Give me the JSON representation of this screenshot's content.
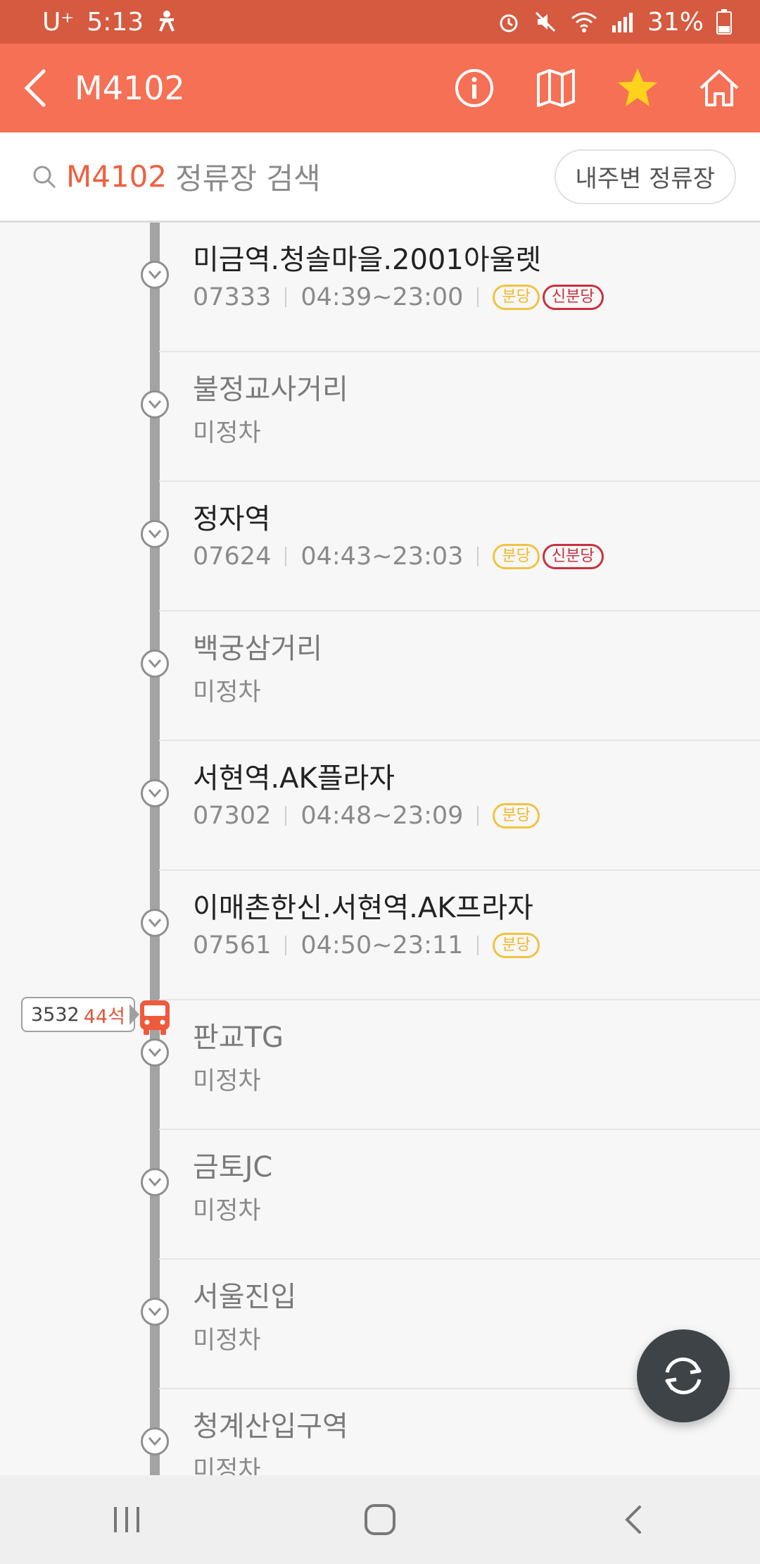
{
  "status": {
    "carrier": "U⁺",
    "time": "5:13",
    "battery": "31%"
  },
  "app_bar": {
    "title": "M4102"
  },
  "search": {
    "route": "M4102",
    "placeholder": "정류장 검색",
    "nearby_label": "내주변 정류장"
  },
  "stops": [
    {
      "name": "미금역.청솔마을.2001아울렛",
      "active": true,
      "code": "07333",
      "hours": "04:39~23:00",
      "badges": [
        {
          "text": "분당",
          "color": "yellow"
        },
        {
          "text": "신분당",
          "color": "red"
        }
      ]
    },
    {
      "name": "불정교사거리",
      "active": false,
      "status": "미정차"
    },
    {
      "name": "정자역",
      "active": true,
      "code": "07624",
      "hours": "04:43~23:03",
      "badges": [
        {
          "text": "분당",
          "color": "yellow"
        },
        {
          "text": "신분당",
          "color": "red"
        }
      ]
    },
    {
      "name": "백궁삼거리",
      "active": false,
      "status": "미정차"
    },
    {
      "name": "서현역.AK플라자",
      "active": true,
      "code": "07302",
      "hours": "04:48~23:09",
      "badges": [
        {
          "text": "분당",
          "color": "yellow"
        }
      ]
    },
    {
      "name": "이매촌한신.서현역.AK프라자",
      "active": true,
      "code": "07561",
      "hours": "04:50~23:11",
      "badges": [
        {
          "text": "분당",
          "color": "yellow"
        }
      ]
    },
    {
      "name": "판교TG",
      "active": false,
      "status": "미정차"
    },
    {
      "name": "금토JC",
      "active": false,
      "status": "미정차"
    },
    {
      "name": "서울진입",
      "active": false,
      "status": "미정차"
    },
    {
      "name": "청계산입구역",
      "active": false,
      "status": "미정차"
    }
  ],
  "bus": {
    "number": "3532",
    "seats": "44석"
  },
  "colors": {
    "accent": "#f57055",
    "status_bar": "#d65a3f",
    "badge_yellow": "#f1b82a",
    "badge_red": "#c8303e"
  }
}
